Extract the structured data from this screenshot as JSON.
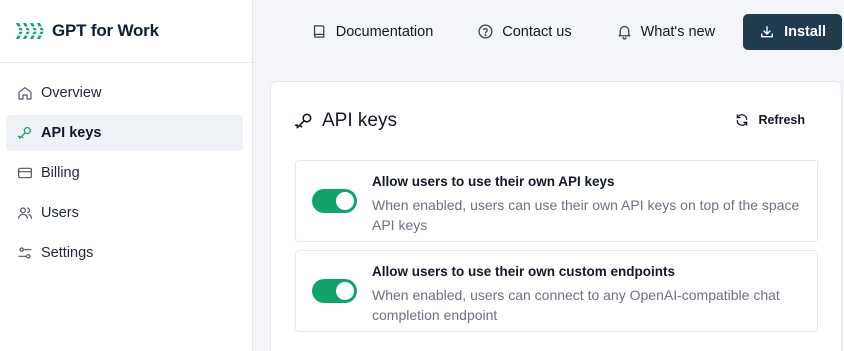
{
  "brand": {
    "name": "GPT for Work",
    "logo_icon": "gpt-for-work-logo",
    "logo_color": "#12a36b"
  },
  "sidebar": {
    "items": [
      {
        "label": "Overview",
        "icon": "home-icon",
        "active": false
      },
      {
        "label": "API keys",
        "icon": "key-icon",
        "active": true
      },
      {
        "label": "Billing",
        "icon": "credit-card-icon",
        "active": false
      },
      {
        "label": "Users",
        "icon": "users-icon",
        "active": false
      },
      {
        "label": "Settings",
        "icon": "sliders-icon",
        "active": false
      }
    ]
  },
  "topbar": {
    "documentation": "Documentation",
    "contact": "Contact us",
    "whats_new": "What's new",
    "install": "Install",
    "install_color": "#1f3b4d"
  },
  "card": {
    "title": "API keys",
    "refresh": "Refresh",
    "settings": [
      {
        "title": "Allow users to use their own API keys",
        "description": "When enabled, users can use their own API keys on top of the space API keys",
        "enabled": true
      },
      {
        "title": "Allow users to use their own custom endpoints",
        "description": "When enabled, users can connect to any OpenAI-compatible chat completion endpoint",
        "enabled": true
      }
    ],
    "toggle_on_color": "#12a36b"
  }
}
